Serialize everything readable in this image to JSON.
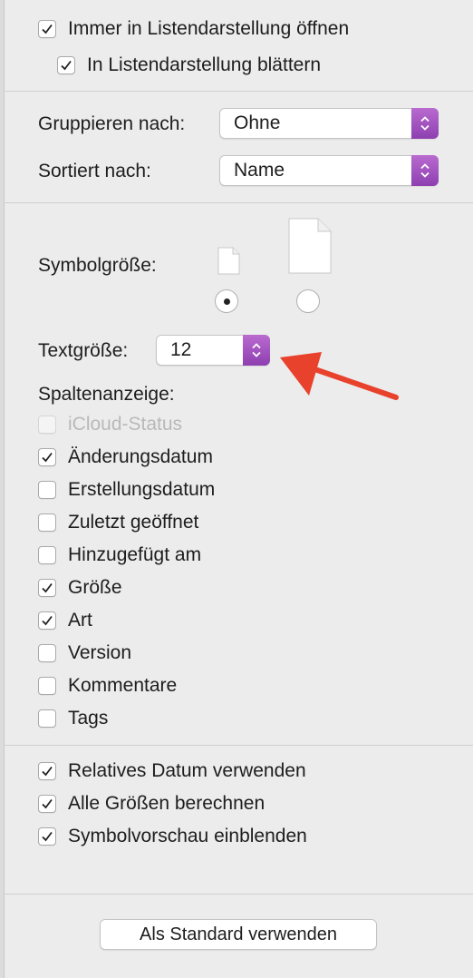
{
  "top_options": [
    {
      "label": "Immer in Listendarstellung öffnen",
      "checked": true
    },
    {
      "label": "In Listendarstellung blättern",
      "checked": true
    }
  ],
  "group_by": {
    "label": "Gruppieren nach:",
    "value": "Ohne"
  },
  "sort_by": {
    "label": "Sortiert nach:",
    "value": "Name"
  },
  "icon_size": {
    "label": "Symbolgröße:",
    "selected": "small"
  },
  "text_size": {
    "label": "Textgröße:",
    "value": "12"
  },
  "columns": {
    "label": "Spaltenanzeige:",
    "items": [
      {
        "label": "iCloud-Status",
        "checked": false,
        "disabled": true
      },
      {
        "label": "Änderungsdatum",
        "checked": true
      },
      {
        "label": "Erstellungsdatum",
        "checked": false
      },
      {
        "label": "Zuletzt geöffnet",
        "checked": false
      },
      {
        "label": "Hinzugefügt am",
        "checked": false
      },
      {
        "label": "Größe",
        "checked": true
      },
      {
        "label": "Art",
        "checked": true
      },
      {
        "label": "Version",
        "checked": false
      },
      {
        "label": "Kommentare",
        "checked": false
      },
      {
        "label": "Tags",
        "checked": false
      }
    ]
  },
  "bottom_options": [
    {
      "label": "Relatives Datum verwenden",
      "checked": true
    },
    {
      "label": "Alle Größen berechnen",
      "checked": true
    },
    {
      "label": "Symbolvorschau einblenden",
      "checked": true
    }
  ],
  "default_button": "Als Standard verwenden",
  "colors": {
    "accent": "#9b4dc0",
    "annotation_arrow": "#e8412c"
  }
}
